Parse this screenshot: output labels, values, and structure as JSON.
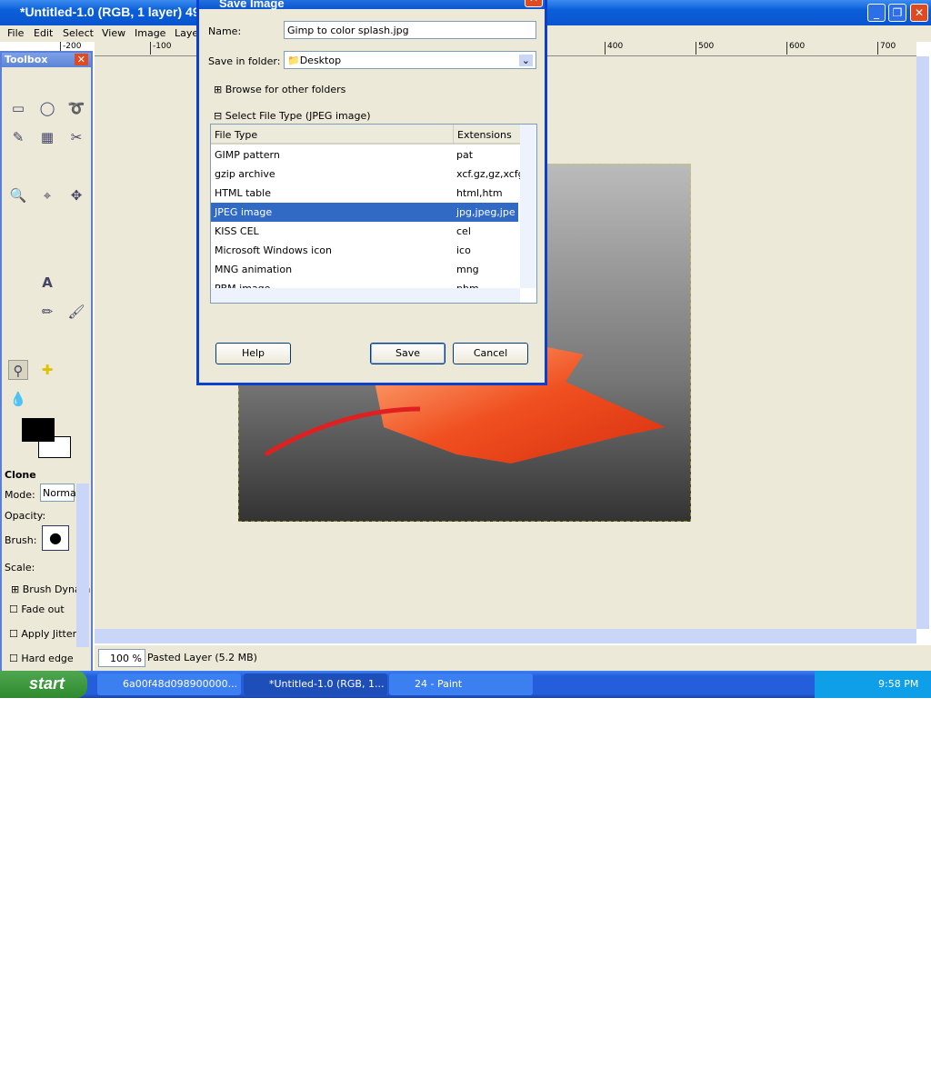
{
  "window": {
    "title": "*Untitled-1.0 (RGB, 1 layer) 49",
    "menu": [
      "File",
      "Edit",
      "Select",
      "View",
      "Image",
      "Laye"
    ]
  },
  "ruler": {
    "labels": [
      "-200",
      "-100",
      "400",
      "500",
      "600",
      "700"
    ]
  },
  "toolbox": {
    "title": "Toolbox",
    "options_title": "Clone",
    "mode_label": "Mode:",
    "mode_value": "Normal",
    "opacity_label": "Opacity:",
    "brush_label": "Brush:",
    "scale_label": "Scale:",
    "brush_dynamics": "Brush Dynam",
    "fade_out": "Fade out",
    "apply_jitter": "Apply Jitter",
    "hard_edge": "Hard edge"
  },
  "status": {
    "zoom": "100 %",
    "layer_info": "Pasted Layer (5.2 MB)"
  },
  "dialog": {
    "title": "Save Image",
    "name_label": "Name:",
    "name_value": "Gimp to color splash.jpg",
    "folder_label": "Save in folder:",
    "folder_value": "Desktop",
    "browse": "Browse for other folders",
    "select_type": "Select File Type (JPEG image)",
    "columns": [
      "File Type",
      "Extensions"
    ],
    "rows": [
      {
        "type": "GIMP pattern",
        "ext": "pat"
      },
      {
        "type": "gzip archive",
        "ext": "xcf.gz,gz,xcfgz"
      },
      {
        "type": "HTML table",
        "ext": "html,htm"
      },
      {
        "type": "JPEG image",
        "ext": "jpg,jpeg,jpe",
        "selected": true
      },
      {
        "type": "KISS CEL",
        "ext": "cel"
      },
      {
        "type": "Microsoft Windows icon",
        "ext": "ico"
      },
      {
        "type": "MNG animation",
        "ext": "mng"
      },
      {
        "type": "PBM image",
        "ext": "pbm"
      }
    ],
    "help": "Help",
    "save": "Save",
    "cancel": "Cancel"
  },
  "taskbar": {
    "start": "start",
    "items": [
      "6a00f48d098900000...",
      "*Untitled-1.0 (RGB, 1...",
      "24 - Paint"
    ],
    "clock": "9:58 PM"
  },
  "colors": {
    "selection": "#316ac5",
    "title_blue": "#0a55d0",
    "face": "#ece9d8"
  }
}
